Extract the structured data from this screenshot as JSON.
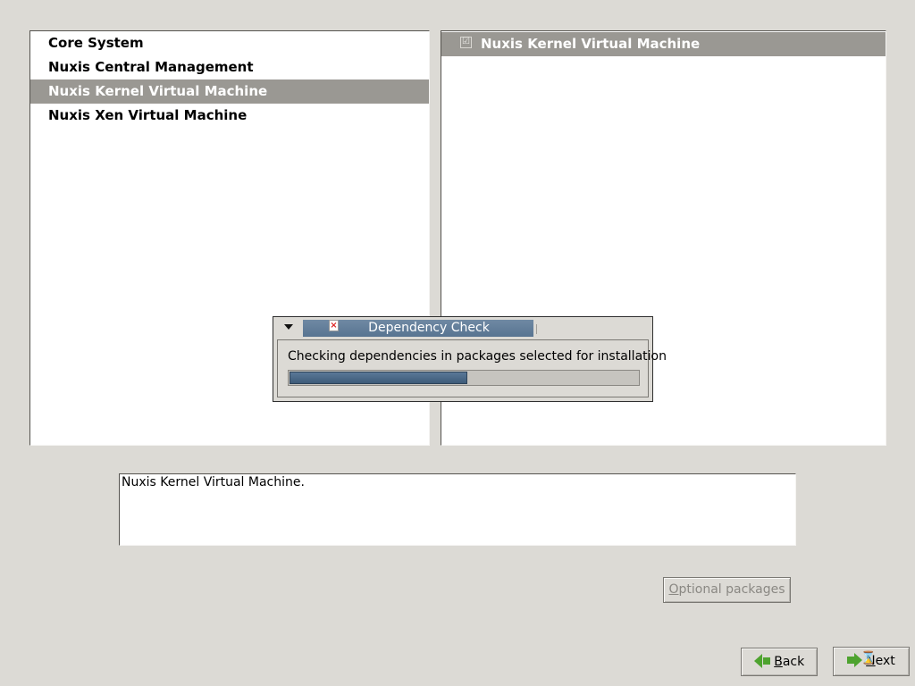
{
  "groups": {
    "items": [
      {
        "label": "Core System"
      },
      {
        "label": "Nuxis Central Management"
      },
      {
        "label": "Nuxis Kernel Virtual Machine",
        "selected": true
      },
      {
        "label": "Nuxis Xen Virtual Machine"
      }
    ]
  },
  "packages": {
    "items": [
      {
        "label": "Nuxis Kernel Virtual Machine",
        "checked": true,
        "check_glyph": "☑"
      }
    ]
  },
  "dependency_dialog": {
    "title": "Dependency Check",
    "title_icon": "x-document-icon",
    "title_icon_glyph": "×",
    "message": "Checking dependencies in packages selected for installation",
    "progress_fraction": 0.51
  },
  "description": {
    "text": "Nuxis Kernel Virtual Machine."
  },
  "buttons": {
    "optional_packages": {
      "mnemonic": "O",
      "rest": "ptional packages",
      "enabled": false
    },
    "back": {
      "mnemonic": "B",
      "rest": "ack",
      "icon": "back-arrow-icon"
    },
    "next": {
      "mnemonic": "N",
      "rest": "ext",
      "icon": "next-arrow-icon"
    }
  },
  "colors": {
    "selection": "#9a9893",
    "progress": "#4a6886",
    "arrow_green": "#4ea32f",
    "window_bg": "#dcdad5"
  }
}
